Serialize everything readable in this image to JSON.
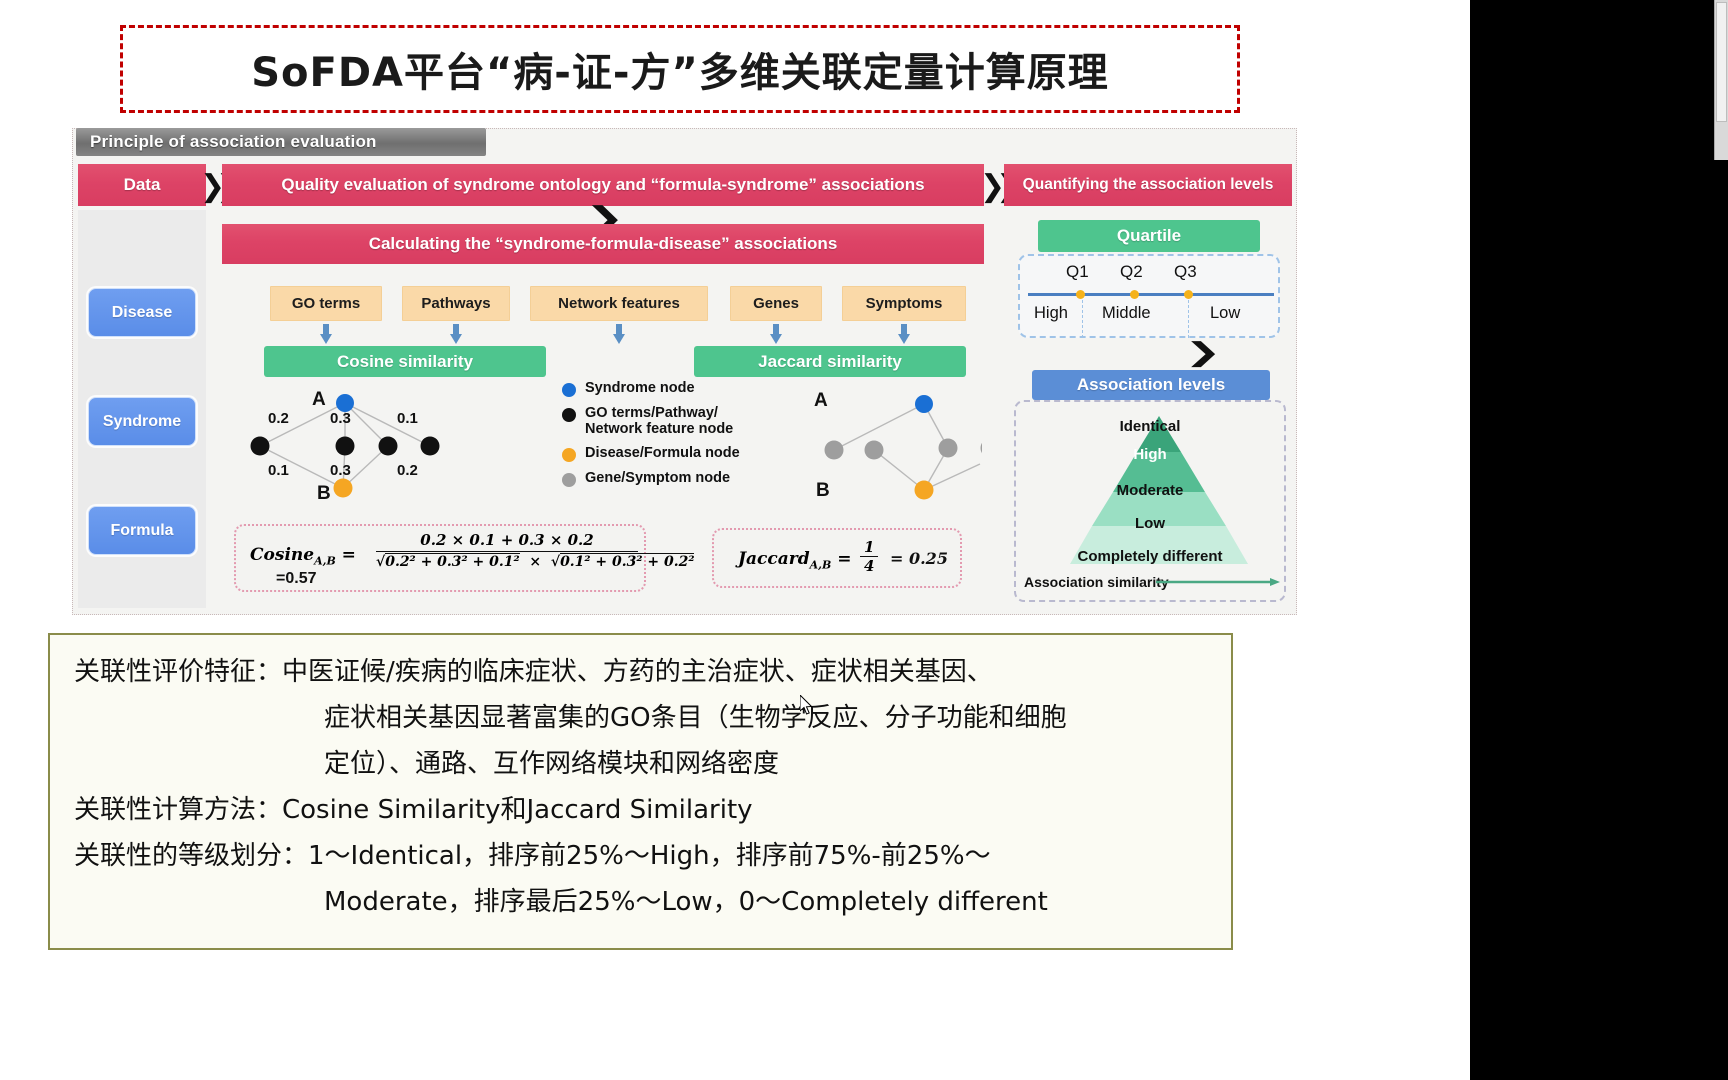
{
  "title": "SoFDA平台“病-证-方”多维关联定量计算原理",
  "figure": {
    "tab_label": "Principle of association evaluation",
    "flow": {
      "data_label": "Data",
      "quality_label": "Quality evaluation of syndrome ontology and “formula-syndrome” associations",
      "quantify_label": "Quantifying the association levels",
      "calculating_label": "Calculating the “syndrome-formula-disease” associations"
    },
    "left_items": [
      "Disease",
      "Syndrome",
      "Formula"
    ],
    "features": [
      "GO terms",
      "Pathways",
      "Network features",
      "Genes",
      "Symptoms"
    ],
    "methods": {
      "cosine": "Cosine similarity",
      "jaccard": "Jaccard similarity"
    },
    "legend": [
      {
        "label": "Syndrome node",
        "color": "#1a6fd4"
      },
      {
        "label": "GO terms/Pathway/ Network feature node",
        "color": "#111111"
      },
      {
        "label": "Disease/Formula node",
        "color": "#f5a623"
      },
      {
        "label": "Gene/Symptom node",
        "color": "#9e9e9e"
      }
    ],
    "cosine_graph": {
      "node_a_label": "A",
      "node_b_label": "B",
      "top_weights": [
        "0.2",
        "0.3",
        "0.1"
      ],
      "bottom_weights": [
        "0.1",
        "0.3",
        "0.2"
      ]
    },
    "jaccard_graph": {
      "node_a_label": "A",
      "node_b_label": "B"
    },
    "cosine_formula": {
      "name": "Cosine",
      "subscript": "A,B",
      "numerator": "0.2 × 0.1 + 0.3 × 0.2",
      "denominator_left": "0.2² + 0.3² + 0.1²",
      "denominator_right": "0.1² + 0.3² + 0.2²",
      "result": "=0.57"
    },
    "jaccard_formula": {
      "name": "Jaccard",
      "subscript": "A,B",
      "numerator": "1",
      "denominator": "4",
      "result": "= 0.25"
    },
    "quartile": {
      "header": "Quartile",
      "ticks": [
        "Q1",
        "Q2",
        "Q3"
      ],
      "bands": [
        "High",
        "Middle",
        "Low"
      ]
    },
    "association": {
      "header": "Association levels",
      "levels": [
        "Identical",
        "High",
        "Moderate",
        "Low",
        "Completely different"
      ],
      "axis_label": "Association similarity"
    }
  },
  "notes": {
    "line1": "关联性评价特征：中医证候/疾病的临床症状、方药的主治症状、症状相关基因、",
    "line2": "症状相关基因显著富集的GO条目（生物学反应、分子功能和细胞",
    "line3": "定位）、通路、互作网络模块和网络密度",
    "line4": "关联性计算方法：Cosine Similarity和Jaccard Similarity",
    "line5": "关联性的等级划分：1～Identical，排序前25%～High，排序前75%-前25%～",
    "line6": "Moderate，排序最后25%～Low，0～Completely different"
  },
  "colors": {
    "title_border": "#c00000",
    "pink": "#dd4366",
    "green": "#4ec58e",
    "blue": "#5b8ed6",
    "tan": "#fad9a8",
    "note_border": "#8a8c4a"
  }
}
